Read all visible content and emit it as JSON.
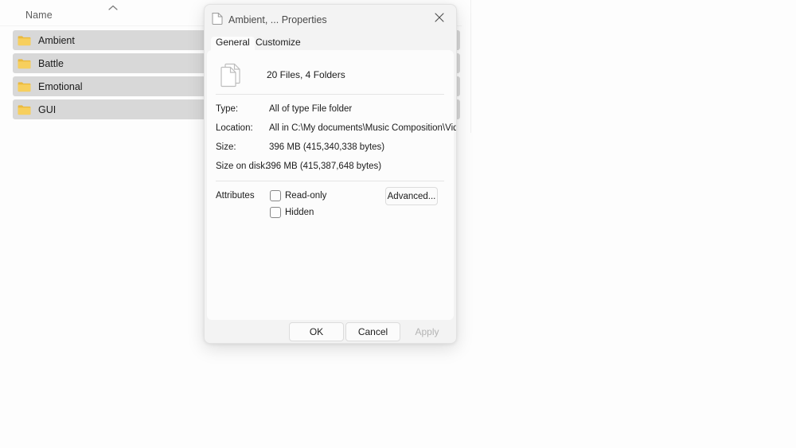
{
  "explorer": {
    "column_header": {
      "name_label": "Name",
      "sort_icon": "chevron-up-icon"
    },
    "rows": [
      {
        "label": "Ambient",
        "icon": "folder-icon"
      },
      {
        "label": "Battle",
        "icon": "folder-icon"
      },
      {
        "label": "Emotional",
        "icon": "folder-icon"
      },
      {
        "label": "GUI",
        "icon": "folder-icon"
      }
    ]
  },
  "dialog": {
    "title": "Ambient, ... Properties",
    "title_icon": "document-icon",
    "close_icon": "close-icon",
    "tabs": [
      {
        "label": "General",
        "active": true
      },
      {
        "label": "Customize",
        "active": false
      }
    ],
    "general": {
      "stack_icon": "multi-document-icon",
      "summary": "20 Files, 4 Folders",
      "fields": [
        {
          "label": "Type:",
          "value": "All of type File folder"
        },
        {
          "label": "Location:",
          "value": "All in C:\\My documents\\Music Composition\\Video"
        },
        {
          "label": "Size:",
          "value": "396 MB (415,340,338 bytes)"
        },
        {
          "label": "Size on disk:",
          "value": "396 MB (415,387,648 bytes)"
        }
      ],
      "attributes_label": "Attributes",
      "checkboxes": [
        {
          "label": "Read-only",
          "checked": false
        },
        {
          "label": "Hidden",
          "checked": false
        }
      ],
      "advanced_button": "Advanced..."
    },
    "footer": {
      "ok_label": "OK",
      "cancel_label": "Cancel",
      "apply_label": "Apply"
    }
  },
  "colors": {
    "selection_row": "#d8d8d8",
    "folder_icon": "#f5c64a",
    "dialog_chrome": "#f3f3f3",
    "content_panel": "#fcfcfc",
    "disabled_text": "#b4b4b4"
  }
}
